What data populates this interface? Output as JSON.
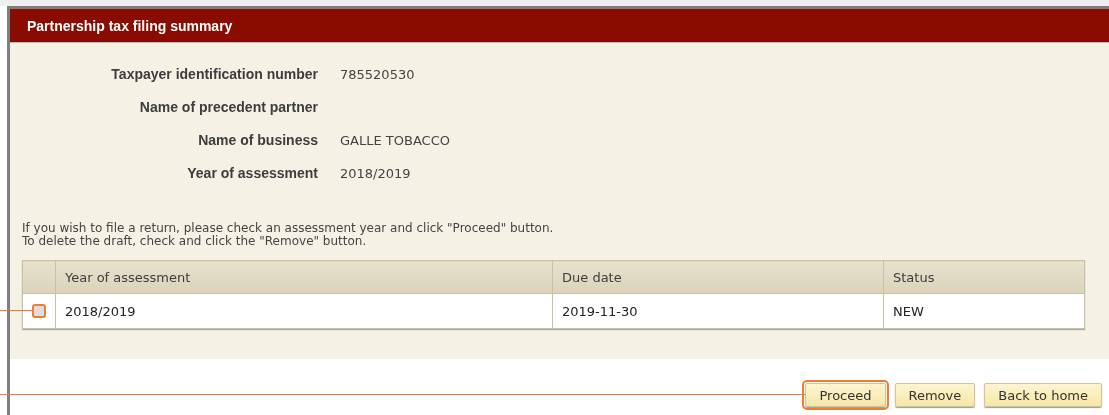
{
  "panel": {
    "title": "Partnership tax filing summary"
  },
  "details": [
    {
      "label": "Taxpayer identification number",
      "value": "785520530"
    },
    {
      "label": "Name of precedent partner"
    },
    {
      "label": "Name of business",
      "value": "GALLE TOBACCO"
    },
    {
      "label": "Year of assessment",
      "value": "2018/2019"
    }
  ],
  "instructions": [
    "If you wish to file a return, please check an assessment year and click \"Proceed\" button.",
    "To delete the draft, check and click the \"Remove\" button."
  ],
  "table": {
    "columns": [
      "Year of assessment",
      "Due date",
      "Status"
    ],
    "rows": [
      {
        "checked": false,
        "highlighted": true,
        "cells": [
          "2018/2019",
          "2019-11-30",
          "NEW"
        ]
      }
    ]
  },
  "buttons": [
    {
      "label": "Proceed",
      "highlighted": true
    },
    {
      "label": "Remove",
      "highlighted": false
    },
    {
      "label": "Back to home",
      "highlighted": false
    }
  ]
}
